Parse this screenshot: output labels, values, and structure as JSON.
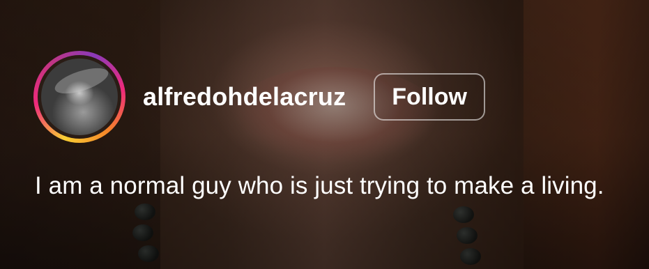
{
  "profile": {
    "avatar_icon": "user-avatar-photo",
    "username": "alfredohdelacruz",
    "follow_label": "Follow"
  },
  "caption": {
    "text": "I am a normal guy who is just trying to make a living."
  },
  "colors": {
    "story_ring": [
      "#f9ce34",
      "#ee2a7b",
      "#8a3ab9"
    ],
    "text": "#ffffff"
  }
}
